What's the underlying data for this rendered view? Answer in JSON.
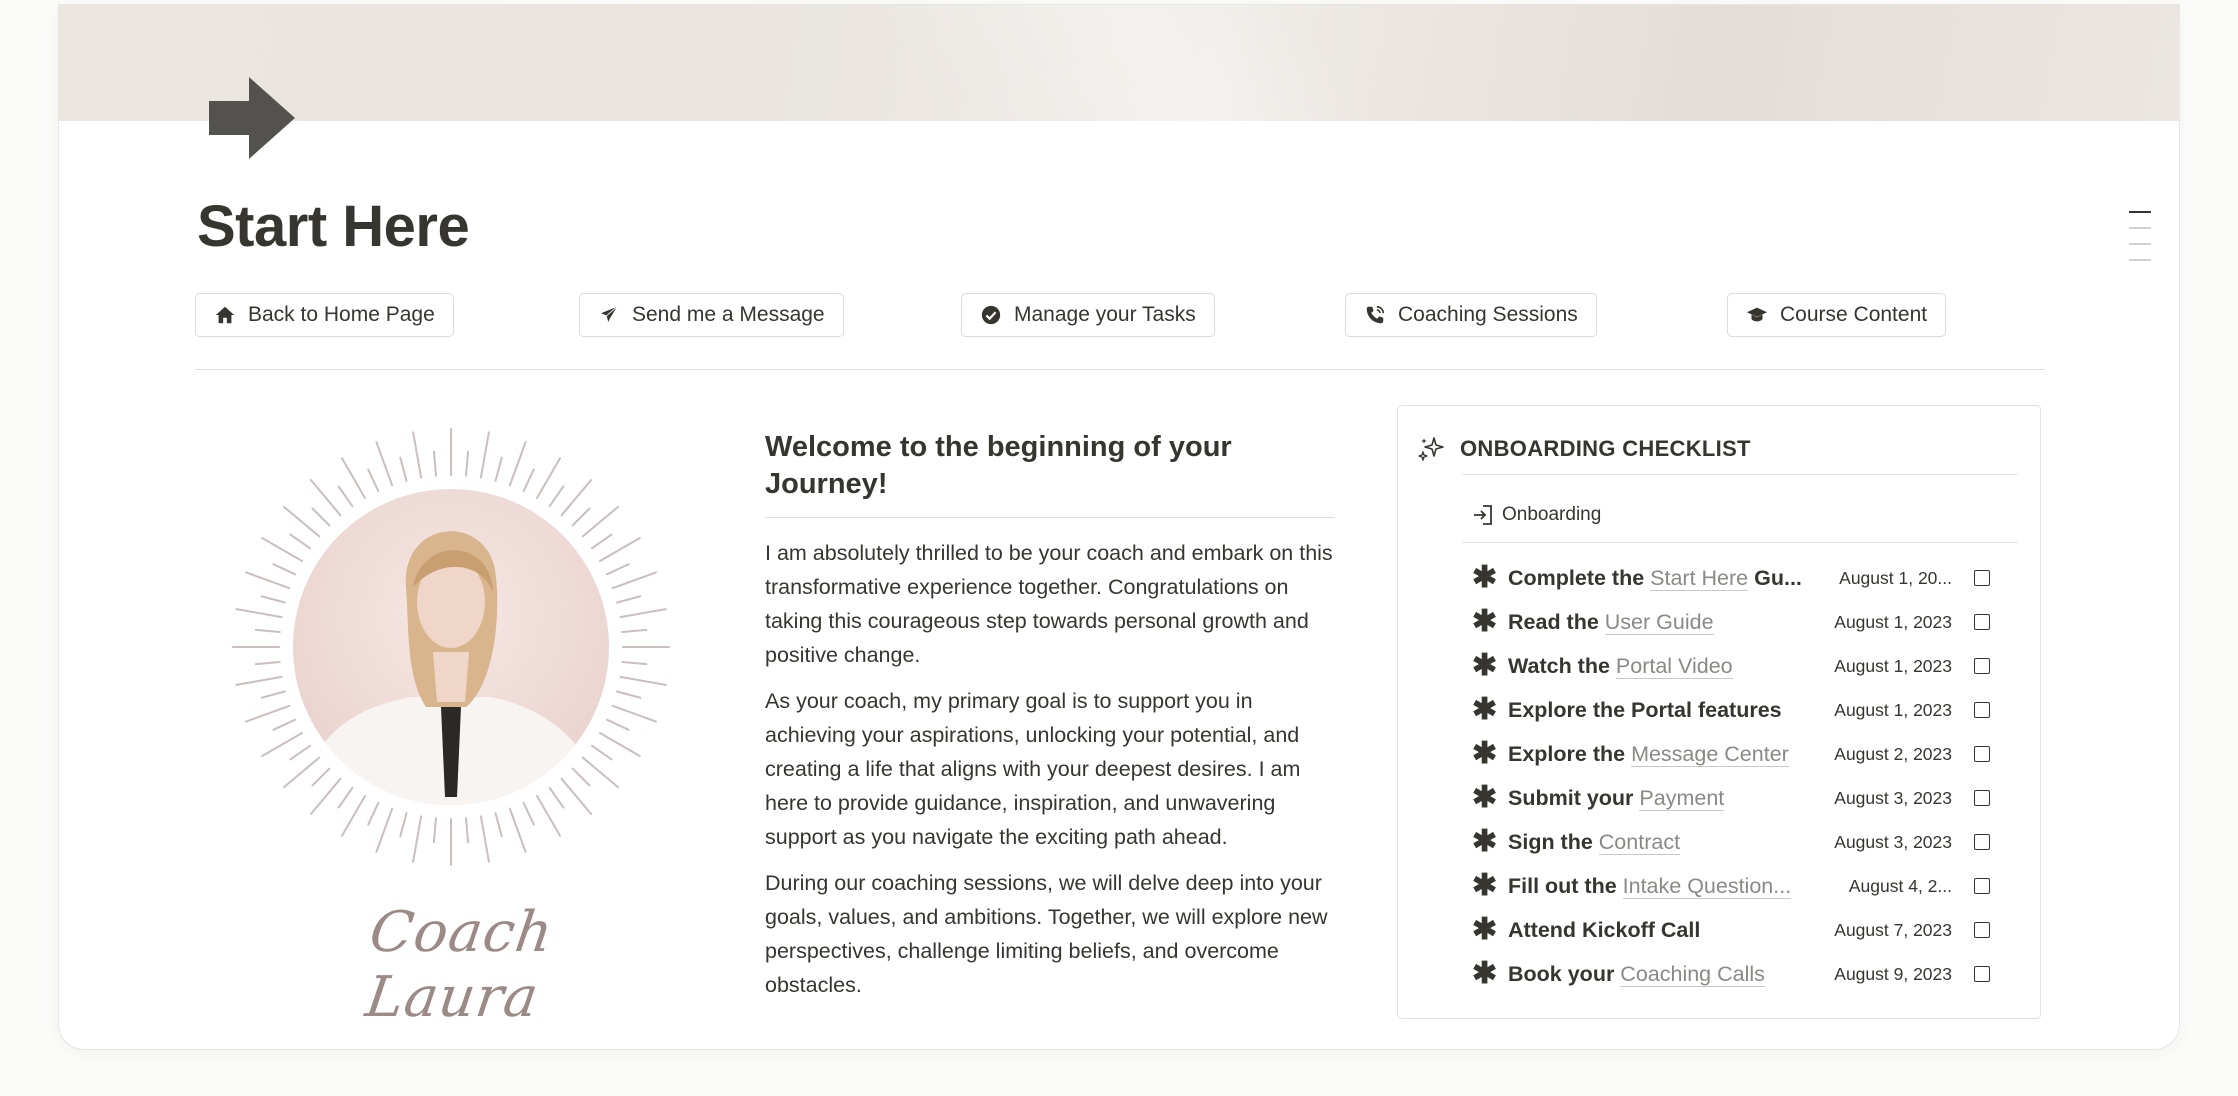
{
  "page": {
    "title": "Start Here",
    "icon": "right-arrow-icon"
  },
  "nav_buttons": [
    {
      "label": "Back to Home Page",
      "icon": "home-icon"
    },
    {
      "label": "Send me a Message",
      "icon": "paper-plane-icon"
    },
    {
      "label": "Manage your Tasks",
      "icon": "check-circle-icon"
    },
    {
      "label": "Coaching Sessions",
      "icon": "phone-call-icon"
    },
    {
      "label": "Course Content",
      "icon": "graduation-cap-icon"
    }
  ],
  "profile": {
    "signature": "Coach Laura"
  },
  "welcome": {
    "heading": "Welcome to the beginning of your Journey!",
    "paragraphs": [
      "I am absolutely thrilled to be your coach and embark on this transformative experience together. Congratulations on taking this courageous step towards personal growth and positive change.",
      "As your coach, my primary goal is to support you in achieving your aspirations, unlocking your potential, and creating a life that aligns with your deepest desires. I am here to provide guidance, inspiration, and unwavering support as you navigate the exciting path ahead.",
      "During our coaching sessions, we will delve deep into your goals, values, and ambitions. Together, we will explore new perspectives, challenge limiting beliefs, and overcome obstacles."
    ]
  },
  "checklist": {
    "title": "ONBOARDING CHECKLIST",
    "view_label": "Onboarding",
    "tasks": [
      {
        "prefix": "Complete the ",
        "link": "Start Here",
        "suffix": " Gu...",
        "date": "August 1, 20...",
        "checked": false
      },
      {
        "prefix": "Read the ",
        "link": "User Guide",
        "suffix": "",
        "date": "August 1, 2023",
        "checked": false
      },
      {
        "prefix": "Watch the ",
        "link": "Portal Video",
        "suffix": "",
        "date": "August 1, 2023",
        "checked": false
      },
      {
        "prefix": "Explore the Portal features",
        "link": "",
        "suffix": "",
        "date": "August 1, 2023",
        "checked": false
      },
      {
        "prefix": "Explore the ",
        "link": "Message Center",
        "suffix": "",
        "date": "August 2, 2023",
        "checked": false
      },
      {
        "prefix": "Submit your ",
        "link": "Payment",
        "suffix": "",
        "date": "August 3, 2023",
        "checked": false
      },
      {
        "prefix": "Sign the ",
        "link": "Contract",
        "suffix": "",
        "date": "August 3, 2023",
        "checked": false
      },
      {
        "prefix": "Fill out the ",
        "link": "Intake Question...",
        "suffix": "",
        "date": "August 4, 2...",
        "checked": false
      },
      {
        "prefix": "Attend Kickoff Call",
        "link": "",
        "suffix": "",
        "date": "August 7, 2023",
        "checked": false
      },
      {
        "prefix": "Book your ",
        "link": "Coaching Calls",
        "suffix": "",
        "date": "August 9, 2023",
        "checked": false
      }
    ]
  },
  "colors": {
    "text": "#37352f",
    "link_muted": "#8b8985",
    "signature": "#9c8a87",
    "sunburst": "#c9bfbd"
  }
}
